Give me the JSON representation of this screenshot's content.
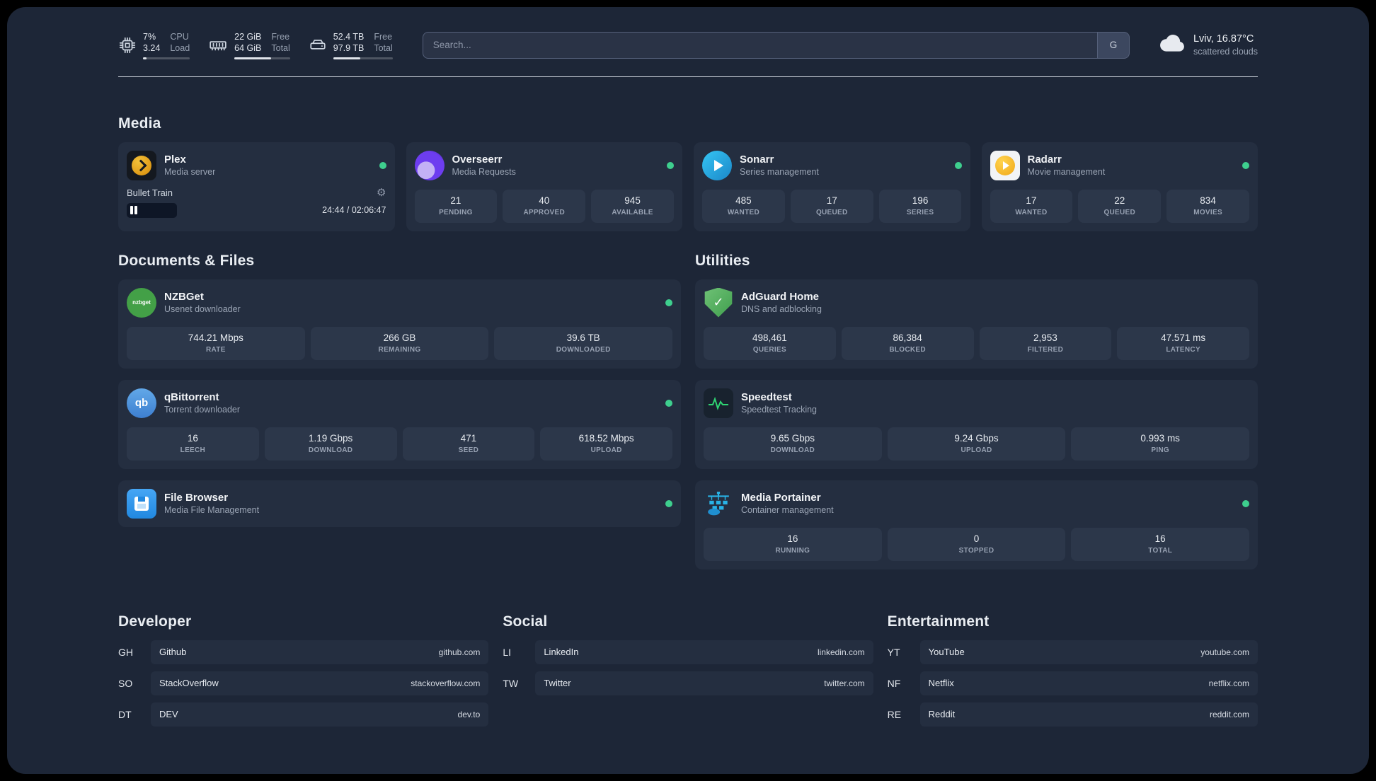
{
  "topbar": {
    "cpu": {
      "value1": "7%",
      "value2": "3.24",
      "label1": "CPU",
      "label2": "Load",
      "bar_style": "width:7%"
    },
    "memory": {
      "value1": "22 GiB",
      "value2": "64 GiB",
      "label1": "Free",
      "label2": "Total",
      "bar_style": "width:66%"
    },
    "disk": {
      "value1": "52.4 TB",
      "value2": "97.9 TB",
      "label1": "Free",
      "label2": "Total",
      "bar_style": "width:46%"
    },
    "search": {
      "placeholder": "Search...",
      "button_label": "G"
    },
    "weather": {
      "location": "Lviv, 16.87°C",
      "condition": "scattered clouds"
    }
  },
  "icons": {
    "gear": "⚙",
    "adguard_check": "✓",
    "nzbget_text": "nzbget",
    "qbittorrent_text": "qb"
  },
  "colors": {
    "status_online": "#3ecf8e",
    "panel_bg": "#1d2637",
    "card_bg": "#242e40"
  },
  "sections": {
    "media": {
      "title": "Media",
      "cards": [
        {
          "title": "Plex",
          "subtitle": "Media server",
          "icon": "plex-icon",
          "status": "online",
          "player": {
            "track": "Bullet Train",
            "time": "24:44 / 02:06:47",
            "progress_style": "width:19%"
          }
        },
        {
          "title": "Overseerr",
          "subtitle": "Media Requests",
          "icon": "overseerr-icon",
          "status": "online",
          "stats": [
            {
              "value": "21",
              "label": "PENDING"
            },
            {
              "value": "40",
              "label": "APPROVED"
            },
            {
              "value": "945",
              "label": "AVAILABLE"
            }
          ]
        },
        {
          "title": "Sonarr",
          "subtitle": "Series management",
          "icon": "sonarr-icon",
          "status": "online",
          "stats": [
            {
              "value": "485",
              "label": "WANTED"
            },
            {
              "value": "17",
              "label": "QUEUED"
            },
            {
              "value": "196",
              "label": "SERIES"
            }
          ]
        },
        {
          "title": "Radarr",
          "subtitle": "Movie management",
          "icon": "radarr-icon",
          "status": "online",
          "stats": [
            {
              "value": "17",
              "label": "WANTED"
            },
            {
              "value": "22",
              "label": "QUEUED"
            },
            {
              "value": "834",
              "label": "MOVIES"
            }
          ]
        }
      ]
    },
    "documents": {
      "title": "Documents & Files",
      "cards": [
        {
          "title": "NZBGet",
          "subtitle": "Usenet downloader",
          "icon": "nzbget-icon",
          "status": "online",
          "stats": [
            {
              "value": "744.21 Mbps",
              "label": "RATE"
            },
            {
              "value": "266 GB",
              "label": "REMAINING"
            },
            {
              "value": "39.6 TB",
              "label": "DOWNLOADED"
            }
          ]
        },
        {
          "title": "qBittorrent",
          "subtitle": "Torrent downloader",
          "icon": "qbittorrent-icon",
          "status": "online",
          "stats": [
            {
              "value": "16",
              "label": "LEECH"
            },
            {
              "value": "1.19 Gbps",
              "label": "DOWNLOAD"
            },
            {
              "value": "471",
              "label": "SEED"
            },
            {
              "value": "618.52 Mbps",
              "label": "UPLOAD"
            }
          ]
        },
        {
          "title": "File Browser",
          "subtitle": "Media File Management",
          "icon": "filebrowser-icon",
          "status": "online"
        }
      ]
    },
    "utilities": {
      "title": "Utilities",
      "cards": [
        {
          "title": "AdGuard Home",
          "subtitle": "DNS and adblocking",
          "icon": "adguard-icon",
          "stats": [
            {
              "value": "498,461",
              "label": "QUERIES"
            },
            {
              "value": "86,384",
              "label": "BLOCKED"
            },
            {
              "value": "2,953",
              "label": "FILTERED"
            },
            {
              "value": "47.571 ms",
              "label": "LATENCY"
            }
          ]
        },
        {
          "title": "Speedtest",
          "subtitle": "Speedtest Tracking",
          "icon": "speedtest-icon",
          "stats": [
            {
              "value": "9.65 Gbps",
              "label": "DOWNLOAD"
            },
            {
              "value": "9.24 Gbps",
              "label": "UPLOAD"
            },
            {
              "value": "0.993 ms",
              "label": "PING"
            }
          ]
        },
        {
          "title": "Media Portainer",
          "subtitle": "Container management",
          "icon": "portainer-icon",
          "status": "online",
          "stats": [
            {
              "value": "16",
              "label": "RUNNING"
            },
            {
              "value": "0",
              "label": "STOPPED"
            },
            {
              "value": "16",
              "label": "TOTAL"
            }
          ]
        }
      ]
    }
  },
  "bookmarks": [
    {
      "title": "Developer",
      "items": [
        {
          "abbr": "GH",
          "name": "Github",
          "url": "github.com"
        },
        {
          "abbr": "SO",
          "name": "StackOverflow",
          "url": "stackoverflow.com"
        },
        {
          "abbr": "DT",
          "name": "DEV",
          "url": "dev.to"
        }
      ]
    },
    {
      "title": "Social",
      "items": [
        {
          "abbr": "LI",
          "name": "LinkedIn",
          "url": "linkedin.com"
        },
        {
          "abbr": "TW",
          "name": "Twitter",
          "url": "twitter.com"
        }
      ]
    },
    {
      "title": "Entertainment",
      "items": [
        {
          "abbr": "YT",
          "name": "YouTube",
          "url": "youtube.com"
        },
        {
          "abbr": "NF",
          "name": "Netflix",
          "url": "netflix.com"
        },
        {
          "abbr": "RE",
          "name": "Reddit",
          "url": "reddit.com"
        }
      ]
    }
  ]
}
